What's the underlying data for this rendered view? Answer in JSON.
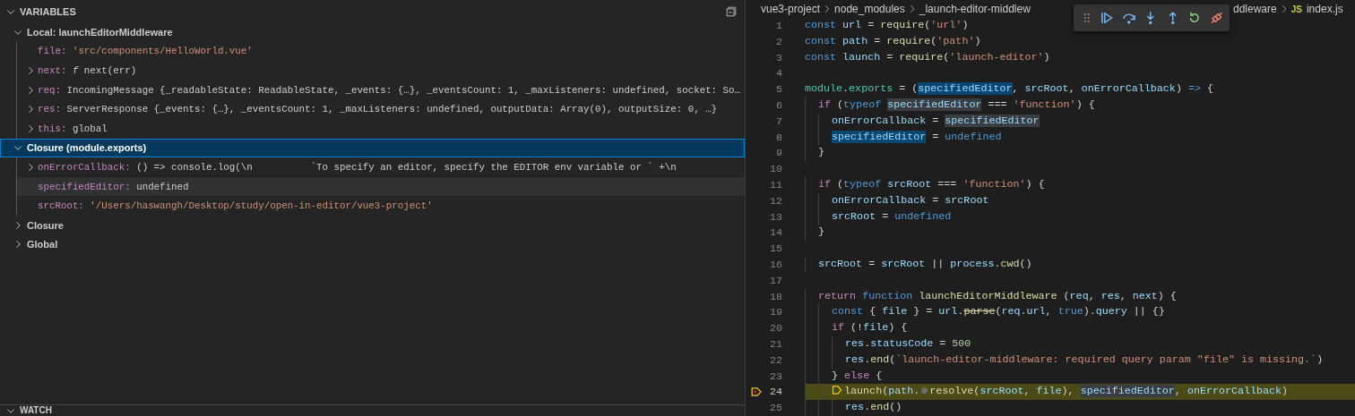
{
  "variables_panel": {
    "title": "VARIABLES",
    "expanded": true,
    "scopes": [
      {
        "label": "Local: launchEditorMiddleware",
        "expanded": true,
        "selected": false,
        "children": [
          {
            "name": "file:",
            "value": "'src/components/HelloWorld.vue'",
            "kind": "string",
            "expandable": false,
            "hovered": false
          },
          {
            "name": "next:",
            "value": "*f* next(err)",
            "kind": "plain",
            "expandable": true,
            "hovered": false
          },
          {
            "name": "req:",
            "value": "IncomingMessage {_readableState: ReadableState, _events: {…}, _eventsCount: 1, _maxListeners: undefined, socket: So…",
            "kind": "plain",
            "expandable": true,
            "hovered": false
          },
          {
            "name": "res:",
            "value": "ServerResponse {_events: {…}, _eventsCount: 1, _maxListeners: undefined, outputData: Array(0), outputSize: 0, …}",
            "kind": "plain",
            "expandable": true,
            "hovered": false
          },
          {
            "name": "this:",
            "value": "global",
            "kind": "plain",
            "expandable": true,
            "hovered": false
          }
        ]
      },
      {
        "label": "Closure (module.exports)",
        "expanded": true,
        "selected": true,
        "children": [
          {
            "name": "onErrorCallback:",
            "value": "() => console.log(\\n          `To specify an editor, specify the EDITOR env variable or ` +\\n",
            "kind": "plain",
            "expandable": true,
            "hovered": false
          },
          {
            "name": "specifiedEditor:",
            "value": "undefined",
            "kind": "plain",
            "expandable": false,
            "hovered": true
          },
          {
            "name": "srcRoot:",
            "value": "'/Users/haswangh/Desktop/study/open-in-editor/vue3-project'",
            "kind": "string",
            "expandable": false,
            "hovered": false
          }
        ]
      },
      {
        "label": "Closure",
        "expanded": false,
        "selected": false
      },
      {
        "label": "Global",
        "expanded": false,
        "selected": false
      }
    ]
  },
  "watch_panel": {
    "title": "WATCH",
    "expanded": true
  },
  "breadcrumb": {
    "segments": [
      "vue3-project",
      "node_modules",
      "_launch-editor-middlew"
    ],
    "after_toolbar": [
      "ddleware"
    ],
    "file_icon": "JS",
    "file": "index.js"
  },
  "editor": {
    "lines": [
      {
        "n": "1",
        "current": false,
        "tokens": [
          {
            "t": "const",
            "kind": "keyword"
          },
          {
            "t": " url",
            "kind": "variable"
          },
          {
            "t": " = ",
            "kind": "plain"
          },
          {
            "t": "require",
            "kind": "function"
          },
          {
            "t": "(",
            "kind": "plain"
          },
          {
            "t": "'url'",
            "kind": "string"
          },
          {
            "t": ")",
            "kind": "plain"
          }
        ]
      },
      {
        "n": "2",
        "current": false,
        "tokens": [
          {
            "t": "const",
            "kind": "keyword"
          },
          {
            "t": " path",
            "kind": "variable"
          },
          {
            "t": " = ",
            "kind": "plain"
          },
          {
            "t": "require",
            "kind": "function"
          },
          {
            "t": "(",
            "kind": "plain"
          },
          {
            "t": "'path'",
            "kind": "string"
          },
          {
            "t": ")",
            "kind": "plain"
          }
        ]
      },
      {
        "n": "3",
        "current": false,
        "tokens": [
          {
            "t": "const",
            "kind": "keyword"
          },
          {
            "t": " launch",
            "kind": "variable"
          },
          {
            "t": " = ",
            "kind": "plain"
          },
          {
            "t": "require",
            "kind": "function"
          },
          {
            "t": "(",
            "kind": "plain"
          },
          {
            "t": "'launch-editor'",
            "kind": "string"
          },
          {
            "t": ")",
            "kind": "plain"
          }
        ]
      },
      {
        "n": "4",
        "current": false
      },
      {
        "n": "5",
        "current": false,
        "tokens": [
          {
            "t": "module",
            "kind": "builtin"
          },
          {
            "t": ".",
            "kind": "plain"
          },
          {
            "t": "exports",
            "kind": "builtin"
          },
          {
            "t": " = (",
            "kind": "plain"
          },
          {
            "t": "specifiedEditor",
            "kind": "write_highlight"
          },
          {
            "t": ", ",
            "kind": "plain"
          },
          {
            "t": "srcRoot",
            "kind": "variable"
          },
          {
            "t": ", ",
            "kind": "plain"
          },
          {
            "t": "onErrorCallback",
            "kind": "variable"
          },
          {
            "t": ") ",
            "kind": "plain"
          },
          {
            "t": "=>",
            "kind": "keyword"
          },
          {
            "t": " {",
            "kind": "plain"
          }
        ]
      },
      {
        "n": "6",
        "current": false,
        "tokens": [
          {
            "t": "  if",
            "kind": "control"
          },
          {
            "t": " (",
            "kind": "plain"
          },
          {
            "t": "typeof ",
            "kind": "keyword"
          },
          {
            "t": "specifiedEditor",
            "kind": "read_highlight"
          },
          {
            "t": " === ",
            "kind": "plain"
          },
          {
            "t": "'function'",
            "kind": "string"
          },
          {
            "t": ") {",
            "kind": "plain"
          }
        ]
      },
      {
        "n": "7",
        "current": false,
        "tokens": [
          {
            "t": "    onErrorCallback",
            "kind": "variable"
          },
          {
            "t": " = ",
            "kind": "plain"
          },
          {
            "t": "specifiedEditor",
            "kind": "read_highlight"
          }
        ]
      },
      {
        "n": "8",
        "current": false,
        "tokens": [
          {
            "t": "    specifiedEditor",
            "kind": "write_highlight"
          },
          {
            "t": " = ",
            "kind": "plain"
          },
          {
            "t": "undefined",
            "kind": "keyword"
          }
        ]
      },
      {
        "n": "9",
        "current": false,
        "tokens": [
          {
            "t": "  }",
            "kind": "plain"
          }
        ]
      },
      {
        "n": "10",
        "current": false
      },
      {
        "n": "11",
        "current": false,
        "tokens": [
          {
            "t": "  if",
            "kind": "control"
          },
          {
            "t": " (",
            "kind": "plain"
          },
          {
            "t": "typeof ",
            "kind": "keyword"
          },
          {
            "t": "srcRoot",
            "kind": "variable"
          },
          {
            "t": " === ",
            "kind": "plain"
          },
          {
            "t": "'function'",
            "kind": "string"
          },
          {
            "t": ") {",
            "kind": "plain"
          }
        ]
      },
      {
        "n": "12",
        "current": false,
        "tokens": [
          {
            "t": "    onErrorCallback",
            "kind": "variable"
          },
          {
            "t": " = ",
            "kind": "plain"
          },
          {
            "t": "srcRoot",
            "kind": "variable"
          }
        ]
      },
      {
        "n": "13",
        "current": false,
        "tokens": [
          {
            "t": "    srcRoot",
            "kind": "variable"
          },
          {
            "t": " = ",
            "kind": "plain"
          },
          {
            "t": "undefined",
            "kind": "keyword"
          }
        ]
      },
      {
        "n": "14",
        "current": false,
        "tokens": [
          {
            "t": "  }",
            "kind": "plain"
          }
        ]
      },
      {
        "n": "15",
        "current": false
      },
      {
        "n": "16",
        "current": false,
        "tokens": [
          {
            "t": "  srcRoot",
            "kind": "variable"
          },
          {
            "t": " = ",
            "kind": "plain"
          },
          {
            "t": "srcRoot",
            "kind": "variable"
          },
          {
            "t": " || ",
            "kind": "plain"
          },
          {
            "t": "process",
            "kind": "variable"
          },
          {
            "t": ".",
            "kind": "plain"
          },
          {
            "t": "cwd",
            "kind": "function"
          },
          {
            "t": "()",
            "kind": "plain"
          }
        ]
      },
      {
        "n": "17",
        "current": false
      },
      {
        "n": "18",
        "current": false,
        "tokens": [
          {
            "t": "  return",
            "kind": "control"
          },
          {
            "t": " function",
            "kind": "keyword"
          },
          {
            "t": " launchEditorMiddleware",
            "kind": "function"
          },
          {
            "t": " (",
            "kind": "plain"
          },
          {
            "t": "req",
            "kind": "variable"
          },
          {
            "t": ", ",
            "kind": "plain"
          },
          {
            "t": "res",
            "kind": "variable"
          },
          {
            "t": ", ",
            "kind": "plain"
          },
          {
            "t": "next",
            "kind": "variable"
          },
          {
            "t": ") {",
            "kind": "plain"
          }
        ]
      },
      {
        "n": "19",
        "current": false,
        "tokens": [
          {
            "t": "    const",
            "kind": "keyword"
          },
          {
            "t": " { ",
            "kind": "plain"
          },
          {
            "t": "file",
            "kind": "variable"
          },
          {
            "t": " } = ",
            "kind": "plain"
          },
          {
            "t": "url",
            "kind": "variable"
          },
          {
            "t": ".",
            "kind": "plain"
          },
          {
            "t": "parse",
            "kind": "deprecated_function"
          },
          {
            "t": "(",
            "kind": "plain"
          },
          {
            "t": "req",
            "kind": "variable"
          },
          {
            "t": ".",
            "kind": "plain"
          },
          {
            "t": "url",
            "kind": "variable"
          },
          {
            "t": ", ",
            "kind": "plain"
          },
          {
            "t": "true",
            "kind": "keyword"
          },
          {
            "t": ").",
            "kind": "plain"
          },
          {
            "t": "query",
            "kind": "variable"
          },
          {
            "t": " || {}",
            "kind": "plain"
          }
        ]
      },
      {
        "n": "20",
        "current": false,
        "tokens": [
          {
            "t": "    if",
            "kind": "control"
          },
          {
            "t": " (!",
            "kind": "plain"
          },
          {
            "t": "file",
            "kind": "variable"
          },
          {
            "t": ") {",
            "kind": "plain"
          }
        ]
      },
      {
        "n": "21",
        "current": false,
        "tokens": [
          {
            "t": "      res",
            "kind": "variable"
          },
          {
            "t": ".",
            "kind": "plain"
          },
          {
            "t": "statusCode",
            "kind": "variable"
          },
          {
            "t": " = ",
            "kind": "plain"
          },
          {
            "t": "500",
            "kind": "number"
          }
        ]
      },
      {
        "n": "22",
        "current": false,
        "tokens": [
          {
            "t": "      res",
            "kind": "variable"
          },
          {
            "t": ".",
            "kind": "plain"
          },
          {
            "t": "end",
            "kind": "function"
          },
          {
            "t": "(",
            "kind": "plain"
          },
          {
            "t": "`launch-editor-middleware: required query param \"file\" is missing.`",
            "kind": "string"
          },
          {
            "t": ")",
            "kind": "plain"
          }
        ]
      },
      {
        "n": "23",
        "current": false,
        "tokens": [
          {
            "t": "    } ",
            "kind": "plain"
          },
          {
            "t": "else",
            "kind": "control"
          },
          {
            "t": " {",
            "kind": "plain"
          }
        ]
      },
      {
        "n": "24",
        "current": true,
        "tokens": [
          {
            "t": "    launch",
            "kind": "paused_call"
          },
          {
            "t": "(",
            "kind": "plain"
          },
          {
            "t": "path",
            "kind": "variable"
          },
          {
            "t": ".",
            "kind": "plain"
          },
          {
            "t": "resolve",
            "kind": "breakpoint_call"
          },
          {
            "t": "(",
            "kind": "plain"
          },
          {
            "t": "srcRoot",
            "kind": "variable"
          },
          {
            "t": ", ",
            "kind": "plain"
          },
          {
            "t": "file",
            "kind": "variable"
          },
          {
            "t": "), ",
            "kind": "plain"
          },
          {
            "t": "specifiedEditor",
            "kind": "read_highlight"
          },
          {
            "t": ", ",
            "kind": "plain"
          },
          {
            "t": "onErrorCallback",
            "kind": "variable"
          },
          {
            "t": ")",
            "kind": "plain"
          }
        ]
      },
      {
        "n": "25",
        "current": false,
        "tokens": [
          {
            "t": "      res",
            "kind": "variable"
          },
          {
            "t": ".",
            "kind": "plain"
          },
          {
            "t": "end",
            "kind": "function"
          },
          {
            "t": "()",
            "kind": "plain"
          }
        ]
      }
    ]
  }
}
